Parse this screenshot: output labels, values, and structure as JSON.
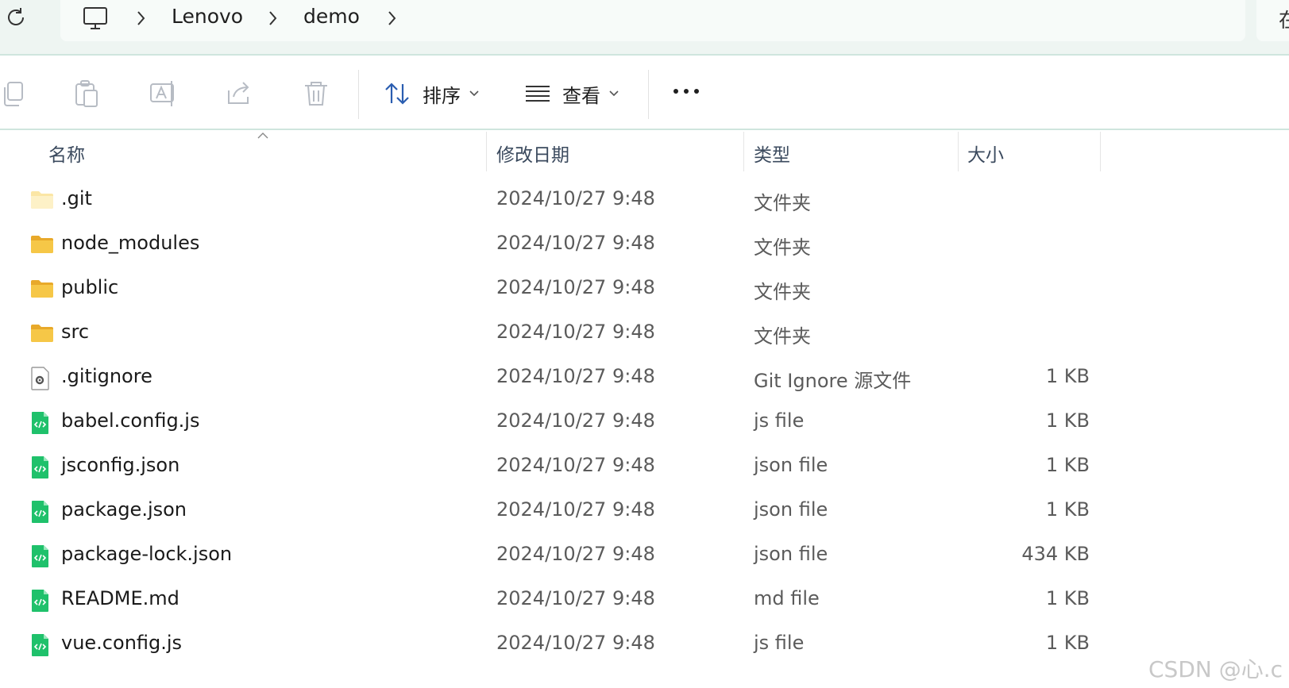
{
  "breadcrumb": {
    "items": [
      "Lenovo",
      "demo"
    ],
    "search_stub_char": "在"
  },
  "toolbar": {
    "copy_icon": "copy-icon",
    "paste_icon": "paste-icon",
    "rename_icon": "rename-icon",
    "share_icon": "share-icon",
    "delete_icon": "trash-icon",
    "sort_label": "排序",
    "view_label": "查看"
  },
  "columns": {
    "name": "名称",
    "modified": "修改日期",
    "type": "类型",
    "size": "大小"
  },
  "files": [
    {
      "name": ".git",
      "modified": "2024/10/27 9:48",
      "type": "文件夹",
      "size": "",
      "icon": "folder-icon"
    },
    {
      "name": "node_modules",
      "modified": "2024/10/27 9:48",
      "type": "文件夹",
      "size": "",
      "icon": "folder-icon"
    },
    {
      "name": "public",
      "modified": "2024/10/27 9:48",
      "type": "文件夹",
      "size": "",
      "icon": "folder-icon"
    },
    {
      "name": "src",
      "modified": "2024/10/27 9:48",
      "type": "文件夹",
      "size": "",
      "icon": "folder-icon"
    },
    {
      "name": ".gitignore",
      "modified": "2024/10/27 9:48",
      "type": "Git Ignore 源文件",
      "size": "1 KB",
      "icon": "settings-file-icon"
    },
    {
      "name": "babel.config.js",
      "modified": "2024/10/27 9:48",
      "type": "js file",
      "size": "1 KB",
      "icon": "code-file-icon"
    },
    {
      "name": "jsconfig.json",
      "modified": "2024/10/27 9:48",
      "type": "json file",
      "size": "1 KB",
      "icon": "code-file-icon"
    },
    {
      "name": "package.json",
      "modified": "2024/10/27 9:48",
      "type": "json file",
      "size": "1 KB",
      "icon": "code-file-icon"
    },
    {
      "name": "package-lock.json",
      "modified": "2024/10/27 9:48",
      "type": "json file",
      "size": "434 KB",
      "icon": "code-file-icon"
    },
    {
      "name": "README.md",
      "modified": "2024/10/27 9:48",
      "type": "md file",
      "size": "1 KB",
      "icon": "code-file-icon"
    },
    {
      "name": "vue.config.js",
      "modified": "2024/10/27 9:48",
      "type": "js file",
      "size": "1 KB",
      "icon": "code-file-icon"
    }
  ],
  "watermark": "CSDN @心.c",
  "colors": {
    "folder": "#f6c747",
    "code_file": "#1fc16b",
    "accent_line": "#cfe5de"
  }
}
